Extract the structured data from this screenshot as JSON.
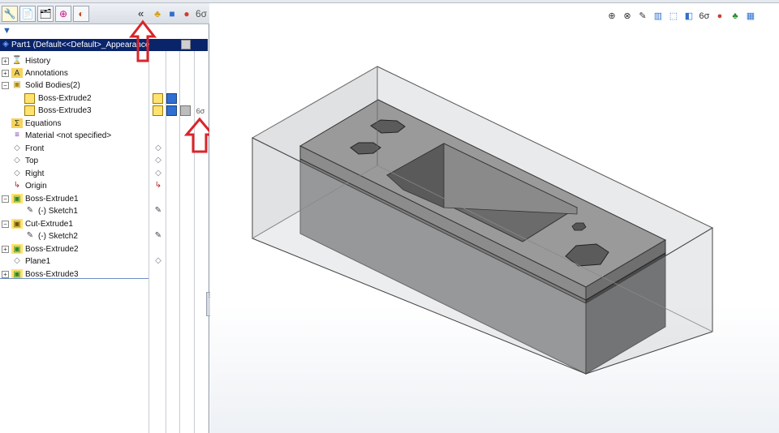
{
  "tabs": [
    {
      "name": "featuremanager-tab",
      "glyph": "🔧"
    },
    {
      "name": "propertymanager-tab",
      "glyph": "📄"
    },
    {
      "name": "configurationmanager-tab",
      "glyph": "🗂"
    },
    {
      "name": "dimxpert-tab",
      "glyph": "⊕"
    },
    {
      "name": "displaymanager-tab",
      "glyph": "◐"
    }
  ],
  "collapse_glyph": "«",
  "filter_glyph": "▼",
  "tree": {
    "root": "Part1  (Default<<Default>_Appearance",
    "items": [
      {
        "label": "History",
        "icon": "history-icon",
        "glyph": "⌛"
      },
      {
        "label": "Annotations",
        "icon": "annotations-icon",
        "glyph": "A"
      },
      {
        "label": "Solid Bodies(2)",
        "icon": "solid-bodies-folder-icon",
        "glyph": "▣"
      },
      {
        "label": "Boss-Extrude2",
        "icon": "body-icon",
        "glyph": "▢"
      },
      {
        "label": "Boss-Extrude3",
        "icon": "body-icon",
        "glyph": "▢"
      },
      {
        "label": "Equations",
        "icon": "equations-icon",
        "glyph": "Σ"
      },
      {
        "label": "Material <not specified>",
        "icon": "material-icon",
        "glyph": "≡"
      },
      {
        "label": "Front",
        "icon": "plane-icon",
        "glyph": "◇"
      },
      {
        "label": "Top",
        "icon": "plane-icon",
        "glyph": "◇"
      },
      {
        "label": "Right",
        "icon": "plane-icon",
        "glyph": "◇"
      },
      {
        "label": "Origin",
        "icon": "origin-icon",
        "glyph": "↳"
      },
      {
        "label": "Boss-Extrude1",
        "icon": "boss-extrude-icon",
        "glyph": "▣"
      },
      {
        "label": "(-) Sketch1",
        "icon": "sketch-icon",
        "glyph": "✎"
      },
      {
        "label": "Cut-Extrude1",
        "icon": "cut-extrude-icon",
        "glyph": "▣"
      },
      {
        "label": "(-) Sketch2",
        "icon": "sketch-icon",
        "glyph": "✎"
      },
      {
        "label": "Boss-Extrude2",
        "icon": "boss-extrude-icon",
        "glyph": "▣"
      },
      {
        "label": "Plane1",
        "icon": "plane-icon",
        "glyph": "◇"
      },
      {
        "label": "Boss-Extrude3",
        "icon": "boss-extrude-icon",
        "glyph": "▣"
      }
    ]
  },
  "annotation_arrow_glyph": "⇧",
  "heads_up": [
    {
      "name": "zoom-to-fit-icon",
      "glyph": "⊕"
    },
    {
      "name": "zoom-area-icon",
      "glyph": "⊗"
    },
    {
      "name": "previous-view-icon",
      "glyph": "✎"
    },
    {
      "name": "section-view-icon",
      "glyph": "▥"
    },
    {
      "name": "view-orientation-icon",
      "glyph": "⬚"
    },
    {
      "name": "display-style-icon",
      "glyph": "◧"
    },
    {
      "name": "hide-show-items-icon",
      "glyph": "6σ"
    },
    {
      "name": "edit-appearance-icon",
      "glyph": "●"
    },
    {
      "name": "apply-scene-icon",
      "glyph": "♣"
    },
    {
      "name": "view-settings-icon",
      "glyph": "▦"
    }
  ],
  "colors": {
    "selection": "#0a246a",
    "annotation_red": "#d9252a",
    "feature_yellow": "#f3c316"
  }
}
